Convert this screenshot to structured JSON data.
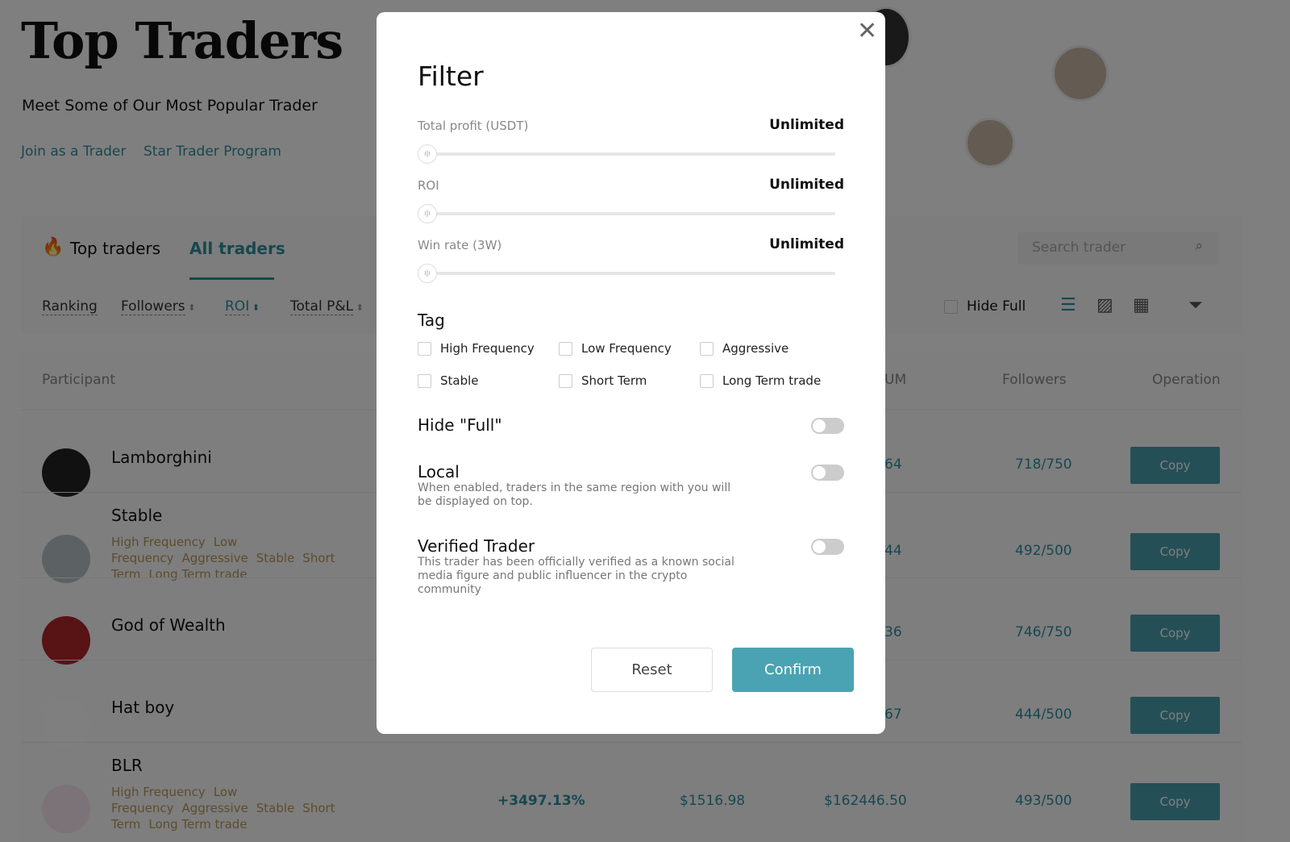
{
  "page": {
    "title": "Top Traders",
    "subtitle": "Meet Some of Our Most Popular Trader",
    "links": [
      "Join as a Trader",
      "Star Trader Program"
    ]
  },
  "tabs": [
    {
      "label": "Top traders",
      "icon": "fire-icon"
    },
    {
      "label": "All traders",
      "active": true
    }
  ],
  "sorts": [
    "Ranking",
    "Followers",
    "ROI",
    "Total P&L"
  ],
  "search": {
    "placeholder": "Search trader"
  },
  "hide_full": "Hide Full",
  "columns": {
    "participant": "Participant",
    "aum": "UM",
    "followers": "Followers",
    "operation": "Operation"
  },
  "rows": [
    {
      "name": "Lamborghini",
      "tags": [],
      "aum": "64",
      "followers": "718/750",
      "op": "Copy"
    },
    {
      "name": "Stable",
      "tags": [
        "High Frequency",
        "Low Frequency",
        "Aggressive",
        "Stable",
        "Short Term",
        "Long Term trade"
      ],
      "aum": "44",
      "followers": "492/500",
      "op": "Copy"
    },
    {
      "name": "God of Wealth",
      "tags": [],
      "aum": "36",
      "followers": "746/750",
      "op": "Copy"
    },
    {
      "name": "Hat boy",
      "tags": [],
      "aum": "67",
      "followers": "444/500",
      "op": "Copy"
    },
    {
      "name": "BLR",
      "tags": [
        "High Frequency",
        "Low Frequency",
        "Aggressive",
        "Stable",
        "Short Term",
        "Long Term trade"
      ],
      "roi": "+3497.13%",
      "pnl": "$1516.98",
      "aum": "$162446.50",
      "followers": "493/500",
      "op": "Copy"
    }
  ],
  "modal": {
    "title": "Filter",
    "sliders": [
      {
        "label": "Total profit (USDT)",
        "value": "Unlimited"
      },
      {
        "label": "ROI",
        "value": "Unlimited"
      },
      {
        "label": "Win rate (3W)",
        "value": "Unlimited"
      }
    ],
    "tag_title": "Tag",
    "tags": [
      "High Frequency",
      "Low Frequency",
      "Aggressive",
      "Stable",
      "Short Term",
      "Long Term trade"
    ],
    "toggles": [
      {
        "label": "Hide \"Full\"",
        "desc": "",
        "on": false
      },
      {
        "label": "Local",
        "desc": "When enabled, traders in the same region with you will be displayed on top.",
        "on": false
      },
      {
        "label": "Verified Trader",
        "desc": "This trader has been officially verified as a known social media figure and public influencer in the crypto community",
        "on": false
      }
    ],
    "reset": "Reset",
    "confirm": "Confirm"
  },
  "colors": {
    "accent": "#2f8fa0",
    "confirm": "#4aa3b2",
    "tag": "#b8995a"
  }
}
